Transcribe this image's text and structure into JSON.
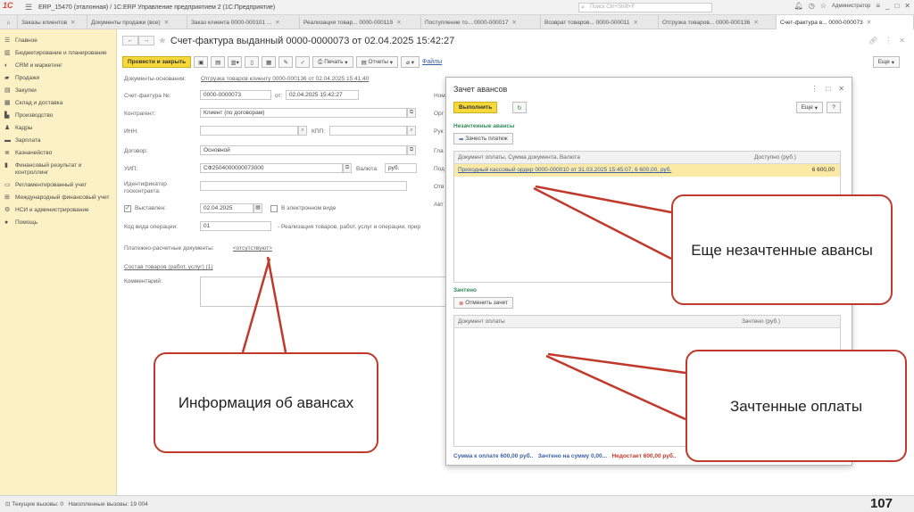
{
  "titlebar": {
    "logo": "1С",
    "title": "ERP_15470 (эталонная) / 1С:ERP Управление предприятием 2  (1С:Предприятие)",
    "search_placeholder": "Поиск Ctrl+Shift+F",
    "user": "Администратор"
  },
  "tabs": [
    {
      "label": "Заказы клиентов"
    },
    {
      "label": "Документы продажи (все)"
    },
    {
      "label": "Заказ клиента 0000-000101 ..."
    },
    {
      "label": "Реализация товар... 0000-000119"
    },
    {
      "label": "Поступление то... 0000-000017"
    },
    {
      "label": "Возврат товаров... 0000-000011"
    },
    {
      "label": "Отгрузка товаров... 0000-000136"
    },
    {
      "label": "Счет-фактура в... 0000-000073"
    }
  ],
  "sidebar": {
    "items": [
      {
        "icon": "menu-icon",
        "label": "Главное"
      },
      {
        "icon": "budget-icon",
        "label": "Бюджетирование и планирование"
      },
      {
        "icon": "crm-icon",
        "label": "CRM и маркетинг"
      },
      {
        "icon": "sales-icon",
        "label": "Продажи"
      },
      {
        "icon": "purchase-icon",
        "label": "Закупки"
      },
      {
        "icon": "warehouse-icon",
        "label": "Склад и доставка"
      },
      {
        "icon": "production-icon",
        "label": "Производство"
      },
      {
        "icon": "staff-icon",
        "label": "Кадры"
      },
      {
        "icon": "salary-icon",
        "label": "Зарплата"
      },
      {
        "icon": "treasury-icon",
        "label": "Казначейство"
      },
      {
        "icon": "finance-icon",
        "label": "Финансовый результат и контроллинг"
      },
      {
        "icon": "regulated-icon",
        "label": "Регламентированный учет"
      },
      {
        "icon": "international-icon",
        "label": "Международный финансовый учет"
      },
      {
        "icon": "admin-icon",
        "label": "НСИ и администрирование"
      },
      {
        "icon": "help-icon",
        "label": "Помощь"
      }
    ]
  },
  "form": {
    "title": "Счет-фактура выданный 0000-0000073 от 02.04.2025 15:42:27",
    "toolbar": {
      "post_close": "Провести и закрыть",
      "print": "Печать",
      "reports": "Отчеты",
      "files": "Файлы",
      "more": "Еще"
    },
    "base_doc_label": "Документы-основания:",
    "base_doc_link": "Отгрузка товаров клиенту 0000-000136 от 02.04.2025 15:41:40",
    "invoice_label": "Счет-фактура №:",
    "invoice_no": "0000-0000073",
    "from_label": "от:",
    "invoice_date": "02.04.2025 15:42:27",
    "contractor_label": "Контрагент:",
    "contractor": "Клиент (по договорам)",
    "inn_label": "ИНН:",
    "kpp_label": "КПП:",
    "contract_label": "Договор:",
    "contract": "Основной",
    "uip_label": "УИП:",
    "uip": "СФ2504000000073000",
    "currency_label": "Валюта:",
    "currency": "руб.",
    "gov_contract_label": "Идентификатор госконтракта:",
    "issued_label": "Выставлен:",
    "issued_date": "02.04.2025",
    "electronic_label": "В электронном виде",
    "op_code_label": "Код вида операции:",
    "op_code": "01",
    "op_code_desc": "- Реализация товаров, работ, услуг и операции, прир",
    "payment_docs_label": "Платежно-расчетные документы:",
    "payment_docs_link": "<отсутствуют>",
    "goods_link": "Состав товаров (работ, услуг) (1)",
    "comment_label": "Комментарий:",
    "right_labels": [
      "Ном",
      "Орг",
      "Рук",
      "Гла",
      "Под",
      "Отв",
      "Авт"
    ]
  },
  "dialog": {
    "title": "Зачет авансов",
    "run_button": "Выполнить",
    "more": "Еще",
    "help": "?",
    "unoffset_section": "Незачтенные авансы",
    "offset_payment_button": "Зачесть платеж",
    "unoffset_table": {
      "headers": [
        "Документ оплаты, Сумма документа, Валюта",
        "Доступно (руб.)"
      ],
      "rows": [
        {
          "document": "Приходный кассовый ордер 0000-000010 от 31.03.2025 15:45:07, 6 600,00, руб.",
          "available": "6 600,00"
        }
      ]
    },
    "offset_section": "Зачтено",
    "cancel_offset_button": "Отменить зачет",
    "offset_table": {
      "headers": [
        "Документ оплаты",
        "Зачтено (руб.)"
      ]
    },
    "totals": {
      "to_pay": "Сумма к оплате 600,00 руб..",
      "offset": "Зачтено на сумму 0,00...",
      "shortage": "Недостает 600,00 руб.."
    }
  },
  "callouts": {
    "unoffset": "Еще незачтенные авансы",
    "advances_info": "Информация об авансах",
    "offset_payments": "Зачтенные оплаты"
  },
  "statusbar": {
    "current_calls": "Текущие вызовы: 0",
    "accumulated_calls": "Накопленные вызовы: 19 004"
  },
  "page_number": "107",
  "colors": {
    "sidebar_bg": "#fbf1c4",
    "primary_button": "#f5d93a",
    "callout_border": "#c0392b",
    "link": "#3b5fa6",
    "section_green": "#2e8b57"
  }
}
